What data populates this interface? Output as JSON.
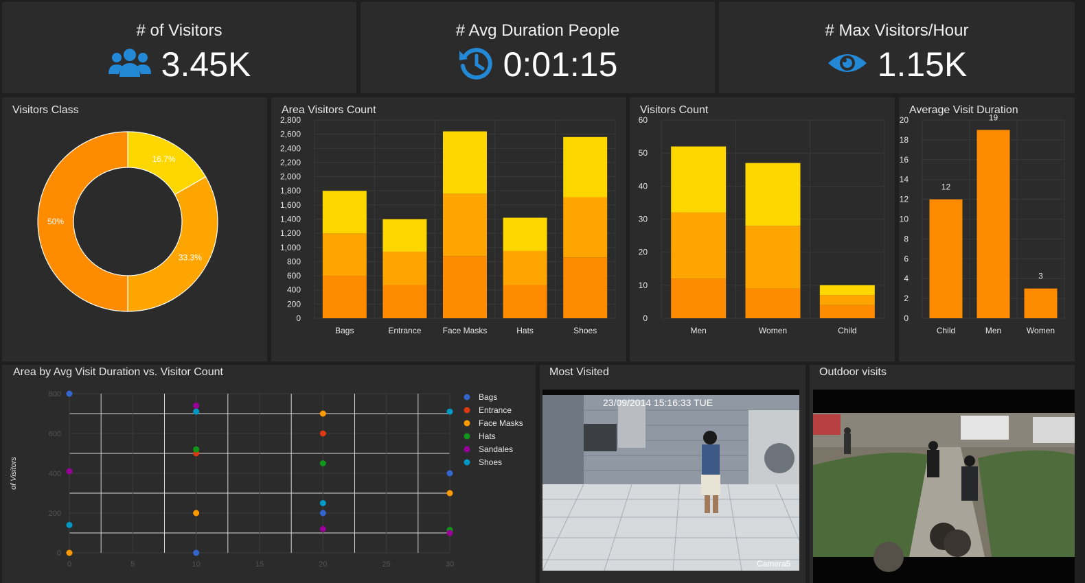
{
  "kpis": [
    {
      "title": "# of Visitors",
      "value": "3.45K",
      "icon": "users-icon"
    },
    {
      "title": "# Avg Duration People",
      "value": "0:01:15",
      "icon": "history-icon"
    },
    {
      "title": "# Max Visitors/Hour",
      "value": "1.15K",
      "icon": "eye-icon"
    }
  ],
  "colors": {
    "accent": "#2389d6",
    "dark_orange": "#ff8c00",
    "orange": "#ffa500",
    "yellow": "#ffd700"
  },
  "visitors_class": {
    "title": "Visitors Class",
    "chart_data": {
      "type": "pie",
      "donut": true,
      "labels": [
        "16.7%",
        "33.3%",
        "50%"
      ],
      "values": [
        16.7,
        33.3,
        50
      ],
      "colors": [
        "#ffd700",
        "#ffa500",
        "#ff8c00"
      ]
    }
  },
  "area_visitors": {
    "title": "Area Visitors Count",
    "chart_data": {
      "type": "bar",
      "stacked": true,
      "categories": [
        "Bags",
        "Entrance",
        "Face Masks",
        "Hats",
        "Shoes"
      ],
      "series": [
        {
          "values": [
            600,
            470,
            880,
            470,
            860
          ],
          "color": "#ff8c00"
        },
        {
          "values": [
            600,
            470,
            880,
            480,
            850
          ],
          "color": "#ffa500"
        },
        {
          "values": [
            600,
            460,
            880,
            470,
            850
          ],
          "color": "#ffd700"
        }
      ],
      "ylim": [
        0,
        2800
      ],
      "yticks": [
        "0",
        "200",
        "400",
        "600",
        "800",
        "1,000",
        "1,200",
        "1,400",
        "1,600",
        "1,800",
        "2,000",
        "2,200",
        "2,400",
        "2,600",
        "2,800"
      ]
    }
  },
  "visitors_count": {
    "title": "Visitors Count",
    "chart_data": {
      "type": "bar",
      "stacked": true,
      "categories": [
        "Men",
        "Women",
        "Child"
      ],
      "series": [
        {
          "values": [
            12,
            9,
            4
          ],
          "color": "#ff8c00"
        },
        {
          "values": [
            20,
            19,
            3
          ],
          "color": "#ffa500"
        },
        {
          "values": [
            20,
            19,
            3
          ],
          "color": "#ffd700"
        }
      ],
      "ylim": [
        0,
        60
      ],
      "yticks": [
        "0",
        "10",
        "20",
        "30",
        "40",
        "50",
        "60"
      ]
    }
  },
  "avg_duration": {
    "title": "Average Visit Duration",
    "chart_data": {
      "type": "bar",
      "categories": [
        "Child",
        "Men",
        "Women"
      ],
      "values": [
        12,
        19,
        3
      ],
      "labels": [
        "12",
        "19",
        "3"
      ],
      "ylim": [
        0,
        20
      ],
      "yticks": [
        "0",
        "2",
        "4",
        "6",
        "8",
        "10",
        "12",
        "14",
        "16",
        "18",
        "20"
      ]
    }
  },
  "scatter": {
    "title": "Area by Avg Visit Duration vs. Visitor Count",
    "chart_data": {
      "type": "scatter",
      "ylabel": "of Visitors",
      "xlim": [
        0,
        30
      ],
      "ylim": [
        0,
        800
      ],
      "xticks": [
        "0",
        "5",
        "10",
        "15",
        "20",
        "25",
        "30"
      ],
      "yticks": [
        "0",
        "200",
        "400",
        "600",
        "800"
      ],
      "series": [
        {
          "name": "Bags",
          "color": "#3366cc",
          "points": [
            [
              0,
              800
            ],
            [
              10,
              0
            ],
            [
              20,
              200
            ],
            [
              30,
              400
            ]
          ]
        },
        {
          "name": "Entrance",
          "color": "#dc3912",
          "points": [
            [
              10,
              500
            ],
            [
              20,
              600
            ],
            [
              30,
              100
            ]
          ]
        },
        {
          "name": "Face Masks",
          "color": "#ff9900",
          "points": [
            [
              0,
              0
            ],
            [
              10,
              200
            ],
            [
              20,
              700
            ],
            [
              30,
              300
            ]
          ]
        },
        {
          "name": "Hats",
          "color": "#109618",
          "points": [
            [
              10,
              520
            ],
            [
              20,
              450
            ],
            [
              30,
              115
            ]
          ]
        },
        {
          "name": "Sandales",
          "color": "#990099",
          "points": [
            [
              0,
              410
            ],
            [
              10,
              740
            ],
            [
              20,
              120
            ],
            [
              30,
              100
            ]
          ]
        },
        {
          "name": "Shoes",
          "color": "#0099c6",
          "points": [
            [
              0,
              140
            ],
            [
              10,
              710
            ],
            [
              20,
              250
            ],
            [
              30,
              710
            ]
          ]
        }
      ]
    }
  },
  "most_visited": {
    "title": "Most Visited",
    "timestamp": "23/09/2014 15:16:33 TUE",
    "camera": "Camera5"
  },
  "outdoor": {
    "title": "Outdoor visits"
  }
}
